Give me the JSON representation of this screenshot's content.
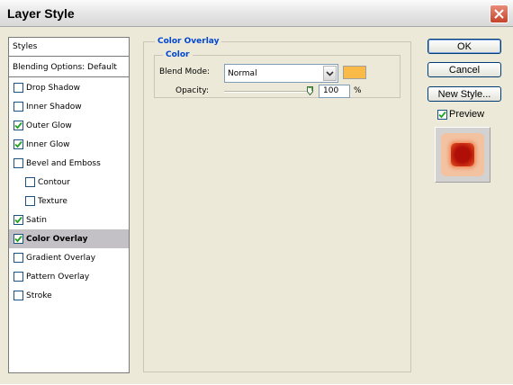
{
  "window": {
    "title": "Layer Style"
  },
  "styles_list": {
    "header": "Styles",
    "blending_options": "Blending Options: Default",
    "items": [
      {
        "label": "Drop Shadow",
        "checked": false,
        "indent": false,
        "selected": false
      },
      {
        "label": "Inner Shadow",
        "checked": false,
        "indent": false,
        "selected": false
      },
      {
        "label": "Outer Glow",
        "checked": true,
        "indent": false,
        "selected": false
      },
      {
        "label": "Inner Glow",
        "checked": true,
        "indent": false,
        "selected": false
      },
      {
        "label": "Bevel and Emboss",
        "checked": false,
        "indent": false,
        "selected": false
      },
      {
        "label": "Contour",
        "checked": false,
        "indent": true,
        "selected": false
      },
      {
        "label": "Texture",
        "checked": false,
        "indent": true,
        "selected": false
      },
      {
        "label": "Satin",
        "checked": true,
        "indent": false,
        "selected": false
      },
      {
        "label": "Color Overlay",
        "checked": true,
        "indent": false,
        "selected": true
      },
      {
        "label": "Gradient Overlay",
        "checked": false,
        "indent": false,
        "selected": false
      },
      {
        "label": "Pattern Overlay",
        "checked": false,
        "indent": false,
        "selected": false
      },
      {
        "label": "Stroke",
        "checked": false,
        "indent": false,
        "selected": false
      }
    ]
  },
  "color_overlay": {
    "section_title": "Color Overlay",
    "group_title": "Color",
    "blend_mode_label": "Blend Mode:",
    "blend_mode_value": "Normal",
    "overlay_color": "#f9ba47",
    "opacity_label": "Opacity:",
    "opacity_value": "100",
    "opacity_unit": "%",
    "opacity_fraction": 1.0
  },
  "buttons": {
    "ok": "OK",
    "cancel": "Cancel",
    "new_style": "New Style..."
  },
  "preview": {
    "label": "Preview",
    "checked": true
  },
  "colors": {
    "section_title": "#0046d5",
    "check": "#21a121",
    "selected_row": "#c3c0c6"
  }
}
